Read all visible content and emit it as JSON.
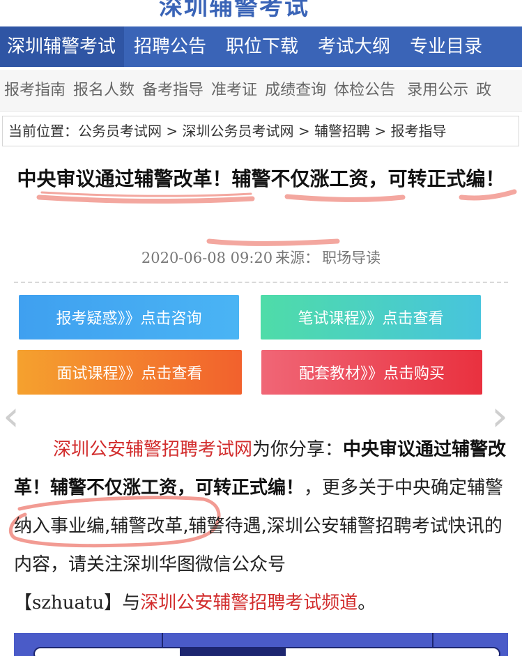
{
  "site": {
    "logo_text": "深圳辅警考试"
  },
  "main_nav": [
    {
      "label": "深圳辅警考试"
    },
    {
      "label": "招聘公告"
    },
    {
      "label": "职位下载"
    },
    {
      "label": "考试大纲"
    },
    {
      "label": "专业目录"
    }
  ],
  "sub_nav": [
    {
      "label": "报考指南"
    },
    {
      "label": "报名人数"
    },
    {
      "label": "备考指导"
    },
    {
      "label": "准考证"
    },
    {
      "label": "成绩查询"
    },
    {
      "label": "体检公告"
    },
    {
      "label": "录用公示"
    },
    {
      "label": "政"
    }
  ],
  "breadcrumb": {
    "prefix": "当前位置：",
    "items": [
      "公务员考试网",
      "深圳公务员考试网",
      "辅警招聘",
      "报考指导"
    ],
    "separator": " > "
  },
  "article": {
    "title": "中央审议通过辅警改革！辅警不仅涨工资，可转正式编！",
    "date": "2020-06-08 09:20",
    "source_label": "来源：",
    "source": "职场导读",
    "body": {
      "link1": "深圳公安辅警招聘考试网",
      "text1": "为你分享：",
      "bold_title": "中央审议通过辅警改革！辅警不仅涨工资，可转正式编！",
      "text2": "，更多关于中央确定辅警纳入事业编,辅警改革,辅警待遇,深圳公安辅警招聘考试快讯的内容，请关注深圳华图微信公众号",
      "wechat": "【szhuatu】",
      "text3": "与",
      "link2": "深圳公安辅警招聘考试频道",
      "text4": "。"
    }
  },
  "cta_buttons": [
    {
      "label": "报考疑惑》》点击咨询",
      "color": "#3fa0f0"
    },
    {
      "label": "笔试课程》》点击查看",
      "color": "#4fdca8"
    },
    {
      "label": "面试课程》》点击查看",
      "color": "#f2612d"
    },
    {
      "label": "配套教材》》点击购买",
      "color": "#e9313f"
    }
  ],
  "carousel": {
    "prev_icon": "chevron-left-icon",
    "next_icon": "chevron-right-icon"
  },
  "colors": {
    "nav_blue": "#3a64b7",
    "link_red": "#d22d2d",
    "highlight": "#f08a80"
  }
}
